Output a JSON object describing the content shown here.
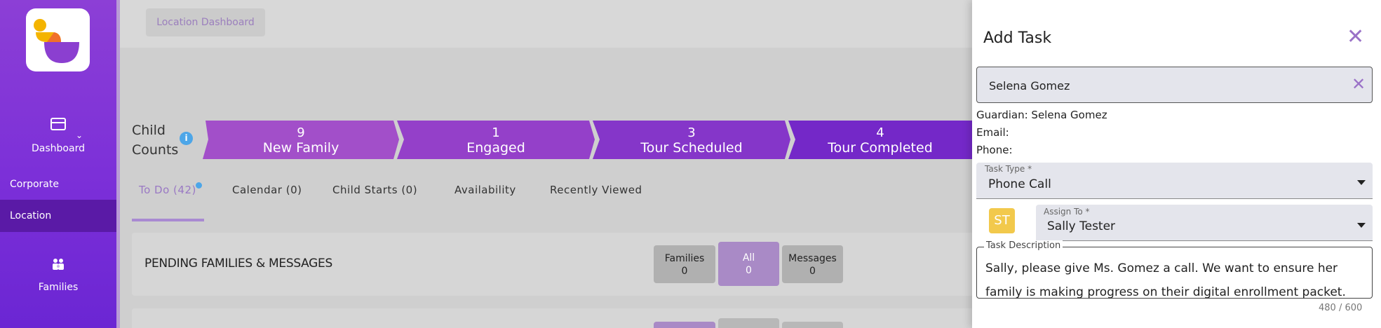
{
  "sidebar": {
    "dashboard_label": "Dashboard",
    "corporate_label": "Corporate",
    "location_label": "Location",
    "families_label": "Families"
  },
  "breadcrumb": "Location Dashboard",
  "child_counts": {
    "line1": "Child",
    "line2": "Counts",
    "info": "i"
  },
  "pipeline": [
    {
      "count": "9",
      "label": "New Family",
      "color": "#a24fc9"
    },
    {
      "count": "1",
      "label": "Engaged",
      "color": "#9440c9"
    },
    {
      "count": "3",
      "label": "Tour Scheduled",
      "color": "#8536c9"
    },
    {
      "count": "4",
      "label": "Tour Completed",
      "color": "#7428c8"
    }
  ],
  "tabs": [
    "To Do (42)",
    "Calendar (0)",
    "Child Starts (0)",
    "Availability",
    "Recently Viewed"
  ],
  "pending": {
    "title": "PENDING FAMILIES & MESSAGES",
    "families_label": "Families",
    "families_count": "0",
    "all_label": "All",
    "all_count": "0",
    "messages_label": "Messages",
    "messages_count": "0"
  },
  "panel": {
    "title": "Add Task",
    "guardian_value": "Selena Gomez",
    "guardian_line": "Guardian: Selena Gomez",
    "email_line": "Email:",
    "phone_line": "Phone:",
    "task_type_label": "Task Type *",
    "task_type_value": "Phone Call",
    "assign_label": "Assign To *",
    "assign_value": "Sally Tester",
    "avatar_initials": "ST",
    "description_label": "Task Description",
    "description_value": "Sally, please give Ms. Gomez a call. We want to ensure her family is making progress on their digital enrollment packet.",
    "counter": "480 / 600"
  },
  "colors": {
    "brand": "#7a2ed8",
    "accent": "#9a72c7"
  }
}
